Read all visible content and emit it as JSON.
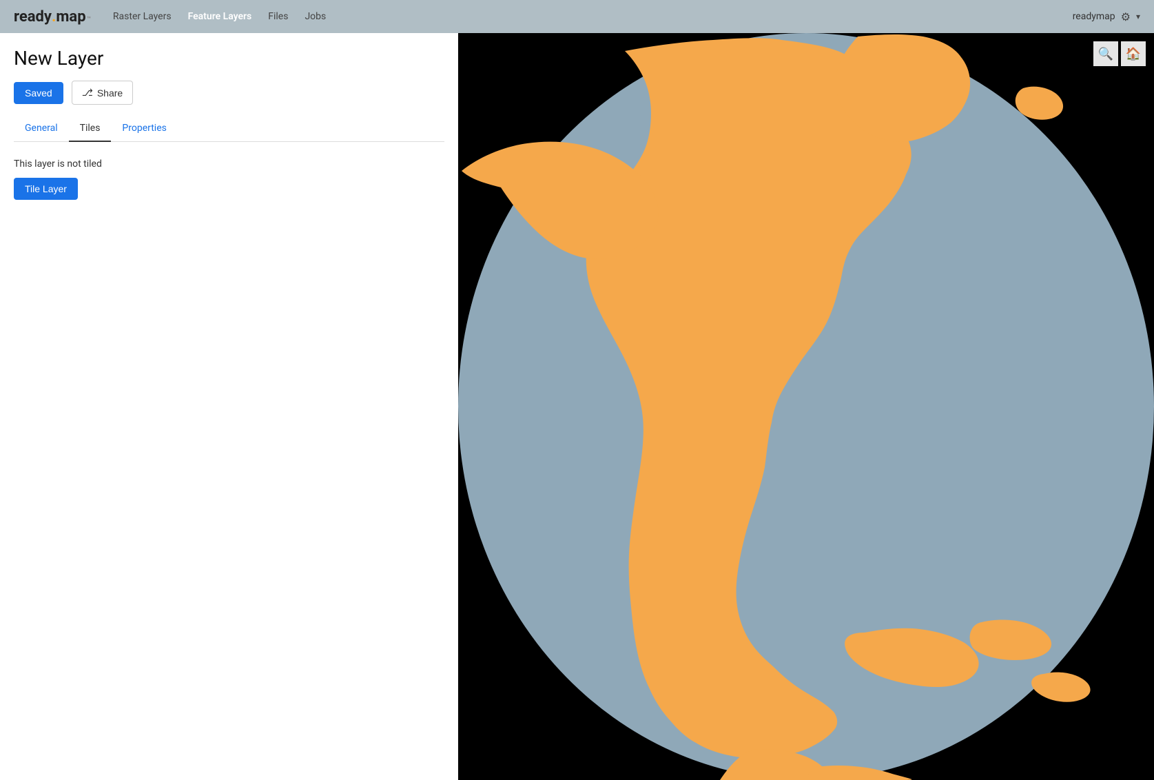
{
  "header": {
    "logo": {
      "ready": "ready",
      "dot": ".",
      "map": "map",
      "tm": "™"
    },
    "nav": [
      {
        "id": "raster-layers",
        "label": "Raster Layers",
        "active": false
      },
      {
        "id": "feature-layers",
        "label": "Feature Layers",
        "active": true
      },
      {
        "id": "files",
        "label": "Files",
        "active": false
      },
      {
        "id": "jobs",
        "label": "Jobs",
        "active": false
      }
    ],
    "user": "readymap",
    "gear_icon": "⚙",
    "chevron_icon": "▾"
  },
  "page": {
    "title": "New Layer"
  },
  "toolbar": {
    "saved_label": "Saved",
    "share_label": "Share",
    "share_icon": "⛉"
  },
  "tabs": [
    {
      "id": "general",
      "label": "General",
      "active": false
    },
    {
      "id": "tiles",
      "label": "Tiles",
      "active": true
    },
    {
      "id": "properties",
      "label": "Properties",
      "active": false
    }
  ],
  "tiles_tab": {
    "not_tiled_message": "This layer is not tiled",
    "tile_layer_button": "Tile Layer"
  },
  "map": {
    "bg_color": "#000000",
    "ocean_color": "#8fa8b8",
    "land_color": "#f5a84b",
    "search_icon": "🔍",
    "home_icon": "🏠"
  }
}
